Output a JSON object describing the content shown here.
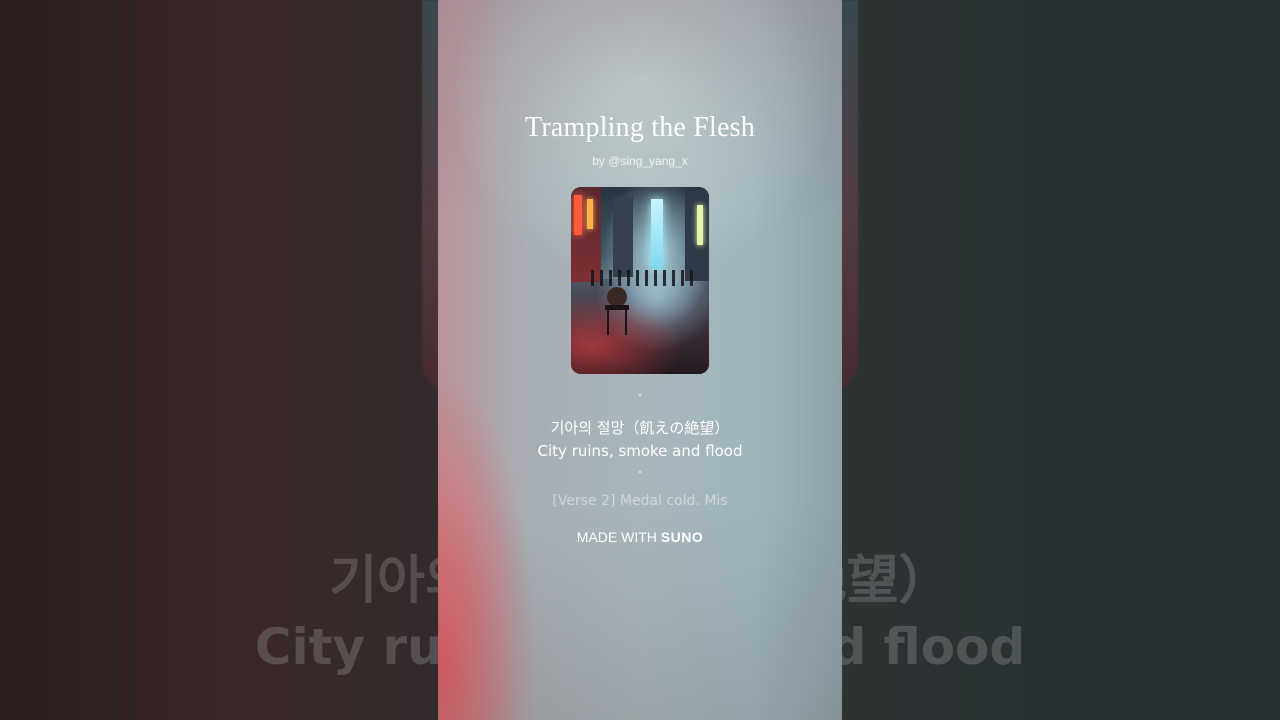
{
  "song": {
    "title": "Trampling the Flesh",
    "byline": "by @sing_yang_x"
  },
  "lyrics": {
    "current_line_1": "기아의 절망（飢えの絶望）",
    "current_line_2": "City ruins, smoke and flood",
    "next_line": "[Verse 2] Medal cold. Mis"
  },
  "background": {
    "line_1": "기아의 절망（飢えの絶望）",
    "line_2": "City ruins, smoke and flood"
  },
  "watermark": {
    "prefix": "MADE WITH",
    "brand": "SUNO"
  },
  "cover_art": {
    "description_icon": "cover-art-image"
  },
  "colors": {
    "accent_red": "#e05a5f",
    "panel_teal": "#a9b6bb"
  }
}
